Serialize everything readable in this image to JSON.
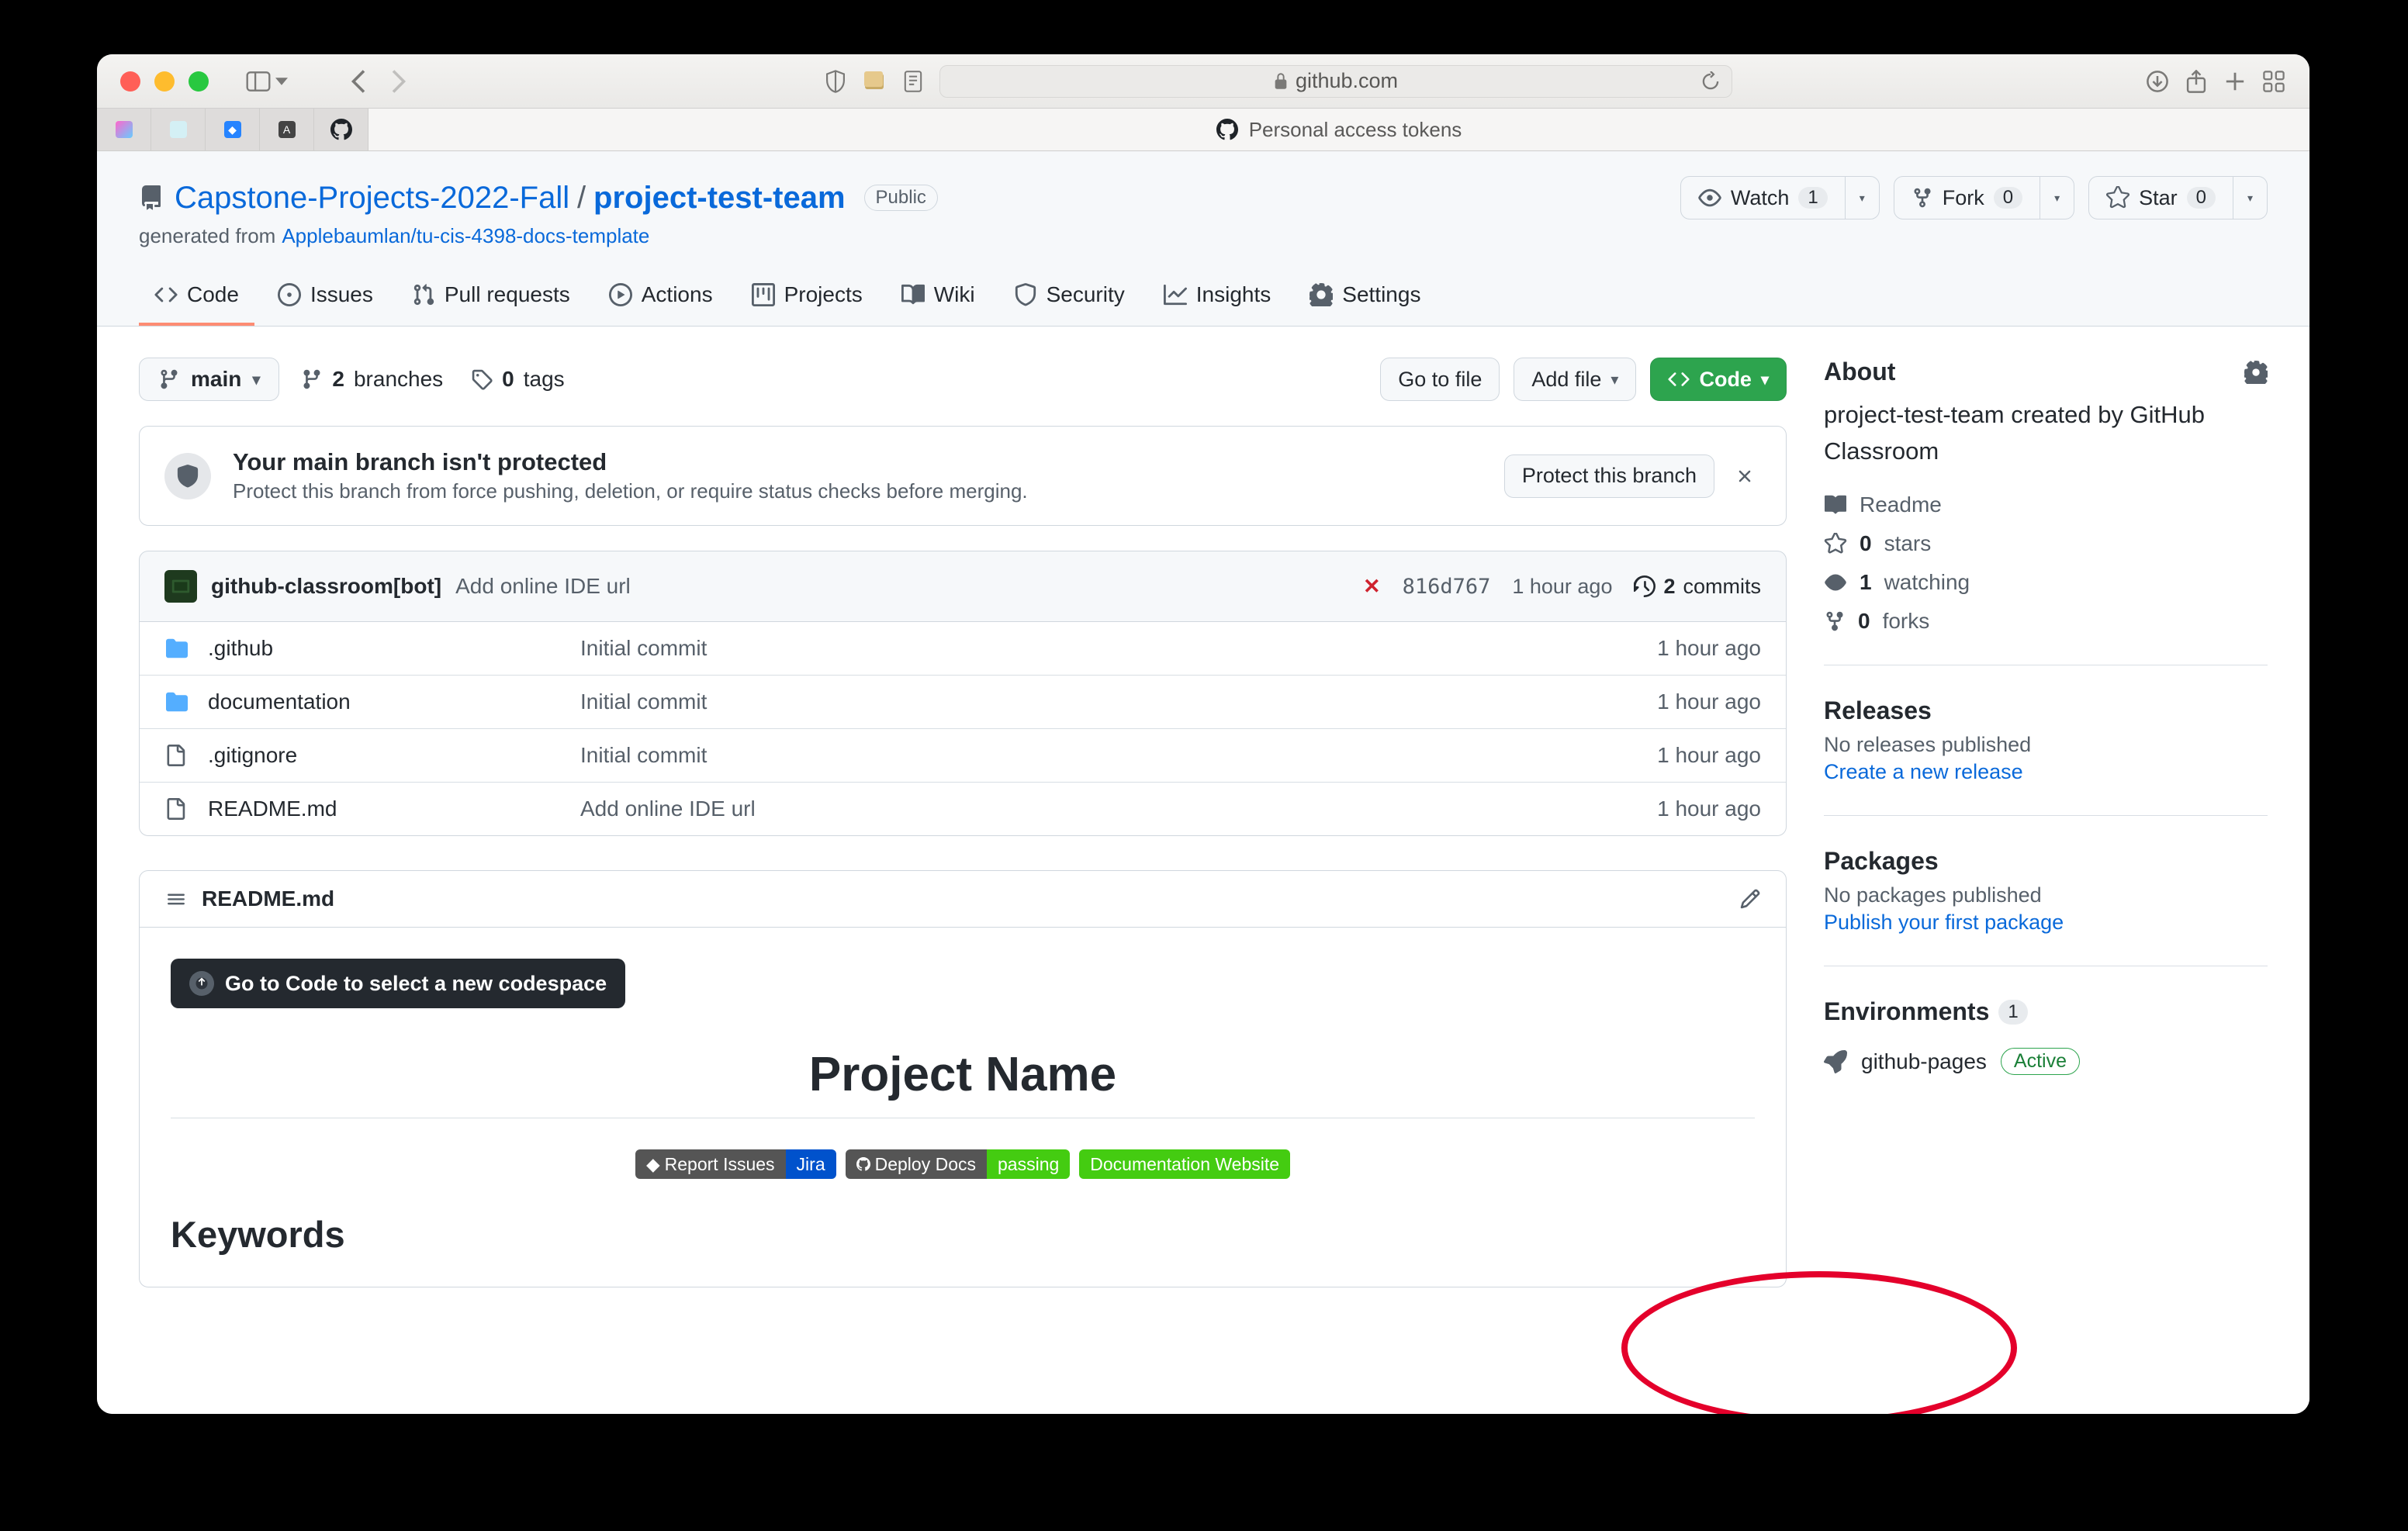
{
  "browser": {
    "domain": "github.com",
    "tab_title": "Personal access tokens"
  },
  "repo": {
    "owner": "Capstone-Projects-2022-Fall",
    "name": "project-test-team",
    "visibility": "Public",
    "generated_label": "generated from",
    "template": "Applebaumlan/tu-cis-4398-docs-template"
  },
  "actions": {
    "watch": "Watch",
    "watch_count": "1",
    "fork": "Fork",
    "fork_count": "0",
    "star": "Star",
    "star_count": "0"
  },
  "nav": {
    "code": "Code",
    "issues": "Issues",
    "pulls": "Pull requests",
    "actions": "Actions",
    "projects": "Projects",
    "wiki": "Wiki",
    "security": "Security",
    "insights": "Insights",
    "settings": "Settings"
  },
  "filebar": {
    "branch": "main",
    "branches_count": "2",
    "branches_label": "branches",
    "tags_count": "0",
    "tags_label": "tags",
    "goto": "Go to file",
    "addfile": "Add file",
    "code": "Code"
  },
  "warn": {
    "title": "Your main branch isn't protected",
    "desc": "Protect this branch from force pushing, deletion, or require status checks before merging.",
    "btn": "Protect this branch"
  },
  "commit": {
    "author": "github-classroom[bot]",
    "msg": "Add online IDE url",
    "sha": "816d767",
    "time": "1 hour ago",
    "commits_count": "2",
    "commits_label": "commits"
  },
  "files": [
    {
      "type": "dir",
      "name": ".github",
      "msg": "Initial commit",
      "time": "1 hour ago"
    },
    {
      "type": "dir",
      "name": "documentation",
      "msg": "Initial commit",
      "time": "1 hour ago"
    },
    {
      "type": "file",
      "name": ".gitignore",
      "msg": "Initial commit",
      "time": "1 hour ago"
    },
    {
      "type": "file",
      "name": "README.md",
      "msg": "Add online IDE url",
      "time": "1 hour ago"
    }
  ],
  "readme": {
    "filename": "README.md",
    "gocode": "Go to Code to select a new codespace",
    "title": "Project Name",
    "badge1_l": "Report Issues",
    "badge1_r": "Jira",
    "badge2_l": "Deploy Docs",
    "badge2_r": "passing",
    "badge3": "Documentation Website",
    "keywords": "Keywords"
  },
  "about": {
    "head": "About",
    "desc": "project-test-team created by GitHub Classroom",
    "readme": "Readme",
    "stars_n": "0",
    "stars_l": "stars",
    "watch_n": "1",
    "watch_l": "watching",
    "forks_n": "0",
    "forks_l": "forks"
  },
  "releases": {
    "head": "Releases",
    "sub": "No releases published",
    "link": "Create a new release"
  },
  "packages": {
    "head": "Packages",
    "sub": "No packages published",
    "link": "Publish your first package"
  },
  "envs": {
    "head": "Environments",
    "count": "1",
    "item": "github-pages",
    "badge": "Active"
  }
}
